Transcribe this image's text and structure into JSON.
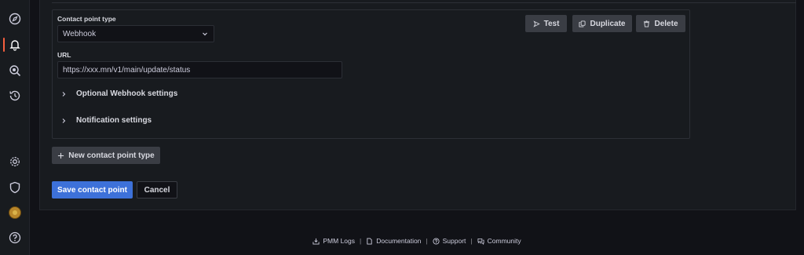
{
  "form": {
    "contact_point_type_label": "Contact point type",
    "contact_point_type_value": "Webhook",
    "url_label": "URL",
    "url_value": "https://xxx.mn/v1/main/update/status",
    "sections": [
      {
        "label": "Optional Webhook settings"
      },
      {
        "label": "Notification settings"
      }
    ],
    "actions": {
      "test": "Test",
      "duplicate": "Duplicate",
      "delete": "Delete"
    },
    "new_type_button": "New contact point type",
    "save_button": "Save contact point",
    "cancel_button": "Cancel"
  },
  "footer": {
    "links": [
      {
        "label": "PMM Logs",
        "icon": "download-icon"
      },
      {
        "label": "Documentation",
        "icon": "document-icon"
      },
      {
        "label": "Support",
        "icon": "question-circle-icon"
      },
      {
        "label": "Community",
        "icon": "comments-icon"
      }
    ],
    "separator": "|"
  },
  "sidebar": {
    "icons": [
      "compass-icon",
      "bell-icon",
      "search-zoom-icon",
      "history-icon",
      "gear-icon",
      "shield-icon",
      "avatar",
      "help-icon"
    ]
  },
  "colors": {
    "accent": "#f55f3e",
    "primary_button": "#3d71d9",
    "background": "#111217",
    "panel": "#181b1f"
  }
}
